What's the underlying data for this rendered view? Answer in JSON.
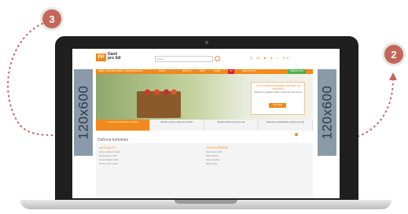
{
  "steps": {
    "left": "3",
    "right": "2"
  },
  "site": {
    "logo_mark": "PP",
    "logo_text": "Daně pro lidi",
    "search_placeholder": "Hledat",
    "top_icons": "✆ ✉ ♟ ★ ⌂ EN",
    "nav": [
      "DANĚ A ÚČETNICTVÍ",
      "MZDY A PERSONALISTIKA",
      "PRÁVO",
      "SMLOUVY",
      "BOZP",
      "VZORY",
      "TIP",
      "MÁTE DOTAZ?"
    ],
    "nav_green": "PŘEDPLATNÉ",
    "ad_left": "120x600",
    "ad_right": "120x600",
    "promo": {
      "title": "Co si musíte uspořádat, aby vám nic neuniklo?",
      "text": "Ještě dnes se přihlaste k odběru novinek a nic vám neuteče.",
      "button": "Vyzkoušet"
    },
    "tabs": [
      "Co si musíte uspořádat v roce 2017",
      "Důležité novinky a lhůty pro rok 2017",
      "Aktuální daňové změny pro vás",
      "Zpracování podnikatelské evidence pro vás"
    ],
    "section_title": "Daňová kartoteka",
    "col1_title": "AKTUALITY",
    "col1_items": [
      "Změny v daňovém zákoně",
      "Novela zákona o DPH",
      "Kontrolní hlášení a lhůty",
      "Přiznání k dani z příjmů"
    ],
    "col2_title": "VÝKON ŘÍZENÍ",
    "col2_items": [
      "Výkon daně z příjmů",
      "Daňové přiznání",
      "Lhůty pro podání",
      "Zálohy na daň"
    ]
  }
}
